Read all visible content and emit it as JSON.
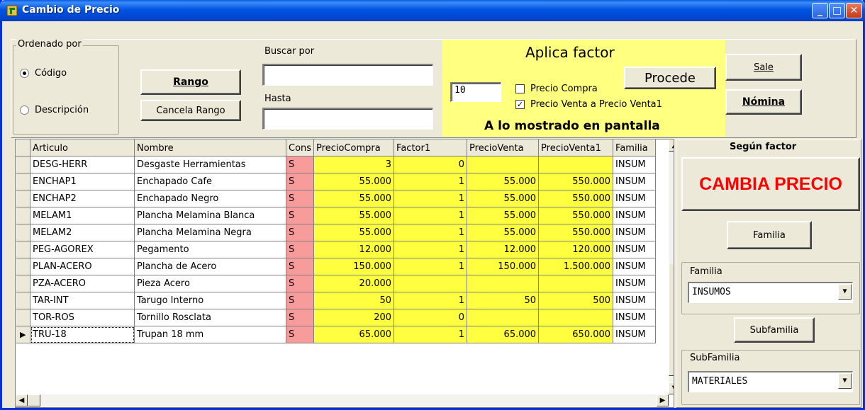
{
  "window": {
    "title": "Cambio de Precio",
    "min": "_",
    "max": "□",
    "close": "✕"
  },
  "ordenado": {
    "label": "Ordenado por",
    "options": [
      "Código",
      "Descripción"
    ],
    "selected": "Código"
  },
  "rango": {
    "rango_button": "Rango",
    "cancela_button": "Cancela Rango",
    "buscar_label": "Buscar por",
    "buscar_value": "",
    "hasta_label": "Hasta",
    "hasta_value": ""
  },
  "factor": {
    "title": "Aplica factor",
    "value": "10",
    "precio_compra_label": "Precio Compra",
    "precio_compra_checked": false,
    "precio_venta_label": "Precio Venta a Precio Venta1",
    "precio_venta_checked": true,
    "procede_button": "Procede",
    "footer": "A lo mostrado en pantalla"
  },
  "right": {
    "sale_button": "Sale",
    "nomina_button": "Nómina",
    "segun_label": "Según factor",
    "cambia_button": "CAMBIA PRECIO",
    "familia_button": "Familia",
    "familia_label": "Familia",
    "familia_value": "INSUMOS",
    "subfamilia_button": "Subfamilia",
    "subfamilia_label": "SubFamilia",
    "subfamilia_value": "MATERIALES",
    "accent": "#ff0000"
  },
  "grid": {
    "columns": [
      "Articulo",
      "Nombre",
      "Cons",
      "PrecioCompra",
      "Factor1",
      "PrecioVenta",
      "PrecioVenta1",
      "Familia"
    ],
    "rows": [
      [
        "DESG-HERR",
        "Desgaste Herramientas",
        "S",
        "3",
        "0",
        "",
        "",
        "INSUM"
      ],
      [
        "ENCHAP1",
        "Enchapado Cafe",
        "S",
        "55.000",
        "1",
        "55.000",
        "550.000",
        "INSUM"
      ],
      [
        "ENCHAP2",
        "Enchapado Negro",
        "S",
        "55.000",
        "1",
        "55.000",
        "550.000",
        "INSUM"
      ],
      [
        "MELAM1",
        "Plancha Melamina Blanca",
        "S",
        "55.000",
        "1",
        "55.000",
        "550.000",
        "INSUM"
      ],
      [
        "MELAM2",
        "Plancha Melamina Negra",
        "S",
        "55.000",
        "1",
        "55.000",
        "550.000",
        "INSUM"
      ],
      [
        "PEG-AGOREX",
        "Pegamento",
        "S",
        "12.000",
        "1",
        "12.000",
        "120.000",
        "INSUM"
      ],
      [
        "PLAN-ACERO",
        "Plancha de Acero",
        "S",
        "150.000",
        "1",
        "150.000",
        "1.500.000",
        "INSUM"
      ],
      [
        "PZA-ACERO",
        "Pieza Acero",
        "S",
        "20.000",
        "",
        "",
        "",
        "INSUM"
      ],
      [
        "TAR-INT",
        "Tarugo Interno",
        "S",
        "50",
        "1",
        "50",
        "500",
        "INSUM"
      ],
      [
        "TOR-ROS",
        "Tornillo Rosclata",
        "S",
        "200",
        "0",
        "",
        "",
        "INSUM"
      ],
      [
        "TRU-18",
        "Trupan 18 mm",
        "S",
        "65.000",
        "1",
        "65.000",
        "650.000",
        "INSUM"
      ]
    ],
    "selected_row": 10
  }
}
